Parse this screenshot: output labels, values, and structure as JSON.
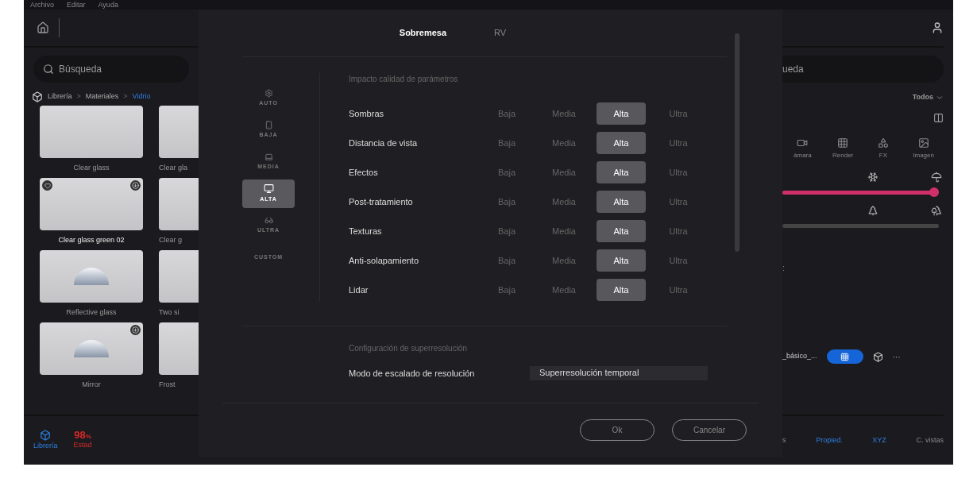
{
  "menu": [
    "Archivo",
    "Editar",
    "Ayuda"
  ],
  "library": {
    "search": {
      "placeholder": "Búsqueda"
    },
    "breadcrumb": [
      "Librería",
      "Materiales",
      "Vidrio"
    ],
    "breadcrumb_separator": ">",
    "materials": [
      {
        "name": "Clear glass",
        "favorite": false,
        "download": false,
        "kind": "plain"
      },
      {
        "name": "Clear gla",
        "kind": "plain"
      },
      {
        "name": "Clear glass green 02",
        "favorite": true,
        "download": true,
        "kind": "plain"
      },
      {
        "name": "Clear g",
        "kind": "plain"
      },
      {
        "name": "Reflective glass",
        "favorite": false,
        "download": false,
        "kind": "chrome"
      },
      {
        "name": "Two si",
        "kind": "plain"
      },
      {
        "name": "Mirror",
        "favorite": false,
        "download": true,
        "kind": "chrome"
      },
      {
        "name": "Frost",
        "kind": "plain"
      }
    ],
    "bottom_tabs": [
      {
        "label": "Librería",
        "kind": "library",
        "selected": true
      },
      {
        "label": "Estad",
        "kind": "stat",
        "value": "98",
        "unit": "%",
        "selected": false
      }
    ]
  },
  "dialog": {
    "tabs": [
      {
        "label": "Sobremesa",
        "selected": true
      },
      {
        "label": "RV",
        "selected": false
      }
    ],
    "presets": [
      {
        "label": "AUTO",
        "kind": "auto",
        "selected": false
      },
      {
        "label": "BAJA",
        "kind": "phone",
        "selected": false
      },
      {
        "label": "MEDIA",
        "kind": "laptop",
        "selected": false
      },
      {
        "label": "ALTA",
        "kind": "monitor",
        "selected": true
      },
      {
        "label": "ULTRA",
        "kind": "ultra",
        "selected": false
      },
      {
        "label": "CUSTOM",
        "kind": "none",
        "selected": false
      }
    ],
    "quality_title": "Impacto calidad de parámetros",
    "quality_rows": [
      {
        "label": "Sombras",
        "options": [
          {
            "label": "Baja",
            "selected": false
          },
          {
            "label": "Media",
            "selected": false
          },
          {
            "label": "Alta",
            "selected": true
          },
          {
            "label": "Ultra",
            "selected": false
          }
        ]
      },
      {
        "label": "Distancia de vista",
        "options": [
          {
            "label": "Baja",
            "selected": false
          },
          {
            "label": "Media",
            "selected": false
          },
          {
            "label": "Alta",
            "selected": true
          },
          {
            "label": "Ultra",
            "selected": false
          }
        ]
      },
      {
        "label": "Efectos",
        "options": [
          {
            "label": "Baja",
            "selected": false
          },
          {
            "label": "Media",
            "selected": false
          },
          {
            "label": "Alta",
            "selected": true
          },
          {
            "label": "Ultra",
            "selected": false
          }
        ]
      },
      {
        "label": "Post-tratamiento",
        "options": [
          {
            "label": "Baja",
            "selected": false
          },
          {
            "label": "Media",
            "selected": false
          },
          {
            "label": "Alta",
            "selected": true
          },
          {
            "label": "Ultra",
            "selected": false
          }
        ]
      },
      {
        "label": "Texturas",
        "options": [
          {
            "label": "Baja",
            "selected": false
          },
          {
            "label": "Media",
            "selected": false
          },
          {
            "label": "Alta",
            "selected": true
          },
          {
            "label": "Ultra",
            "selected": false
          }
        ]
      },
      {
        "label": "Anti-solapamiento",
        "options": [
          {
            "label": "Baja",
            "selected": false
          },
          {
            "label": "Media",
            "selected": false
          },
          {
            "label": "Alta",
            "selected": true
          },
          {
            "label": "Ultra",
            "selected": false
          }
        ]
      },
      {
        "label": "Lidar",
        "options": [
          {
            "label": "Baja",
            "selected": false
          },
          {
            "label": "Media",
            "selected": false
          },
          {
            "label": "Alta",
            "selected": true
          },
          {
            "label": "Ultra",
            "selected": false
          }
        ]
      }
    ],
    "superres_title": "Configuración de superresolución",
    "superres_label": "Modo de escalado de resolución",
    "superres_value": "Superresolución temporal",
    "buttons": [
      "Ok",
      "Cancelar"
    ]
  },
  "right": {
    "search_text": "ueda",
    "filter": "Todos",
    "tools": [
      {
        "label": "ámara",
        "kind": "camera"
      },
      {
        "label": "Render",
        "kind": "render"
      },
      {
        "label": "FX",
        "kind": "fx"
      },
      {
        "label": "Imagen",
        "kind": "image"
      }
    ],
    "sliders": [
      {
        "level": 0.99,
        "kind": "weather"
      },
      {
        "kind": "vegetation"
      }
    ],
    "grid_on": true,
    "colon": ":",
    "preset_name": "_básico_...",
    "more": "···",
    "bottom_tabs": [
      {
        "label": "s",
        "selected": false
      },
      {
        "label": "Propied.",
        "selected": true
      },
      {
        "label": "XYZ",
        "selected": true
      },
      {
        "label": "C. vistas",
        "selected": false
      }
    ]
  }
}
